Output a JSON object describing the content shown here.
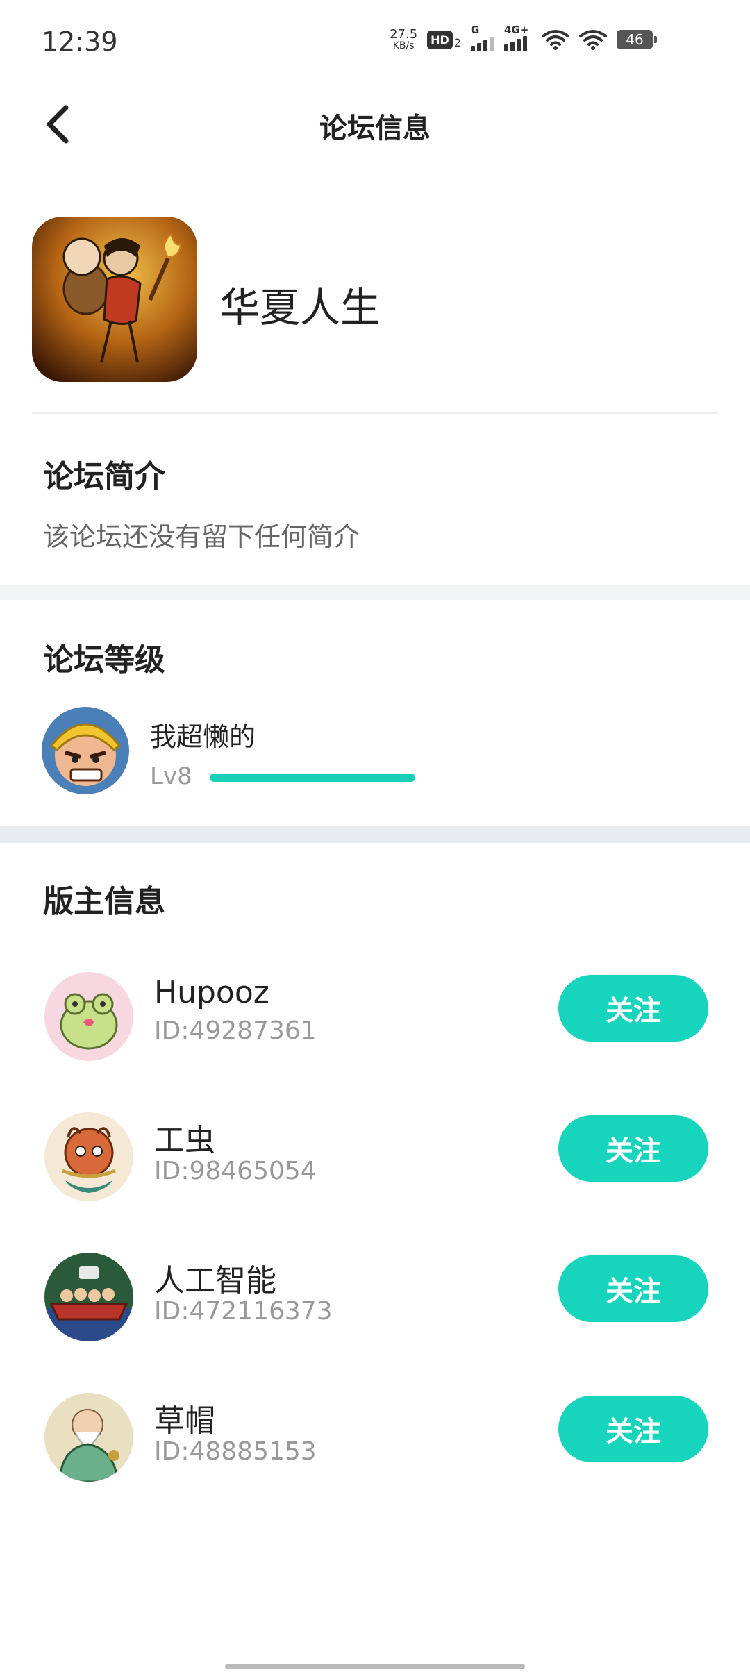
{
  "status_bar": {
    "time": "12:39",
    "net_speed_value": "27.5",
    "net_speed_unit": "KB/s",
    "hd_label": "HD",
    "hd_sub": "2",
    "signal1_label": "G",
    "signal2_label": "4G+",
    "battery": "46",
    "icons": [
      "hd-icon",
      "signal-icon",
      "signal-icon",
      "wifi-icon",
      "wifi-icon",
      "battery-icon"
    ]
  },
  "header": {
    "title": "论坛信息",
    "back_icon": "chevron-left-icon"
  },
  "forum": {
    "name": "华夏人生",
    "logo_icon": "game-logo"
  },
  "intro": {
    "title": "论坛简介",
    "text": "该论坛还没有留下任何简介"
  },
  "level": {
    "title": "论坛等级",
    "user_name": "我超懒的",
    "level_text": "Lv8",
    "progress": 1.0
  },
  "moderators": {
    "title": "版主信息",
    "items": [
      {
        "name": "Hupooz",
        "id": "ID:49287361",
        "follow_label": "关注"
      },
      {
        "name": "工虫",
        "id": "ID:98465054",
        "follow_label": "关注"
      },
      {
        "name": "人工智能",
        "id": "ID:472116373",
        "follow_label": "关注"
      },
      {
        "name": "草帽",
        "id": "ID:48885153",
        "follow_label": "关注"
      }
    ]
  },
  "colors": {
    "accent": "#17d4bd",
    "band": "#f3f4f6"
  }
}
